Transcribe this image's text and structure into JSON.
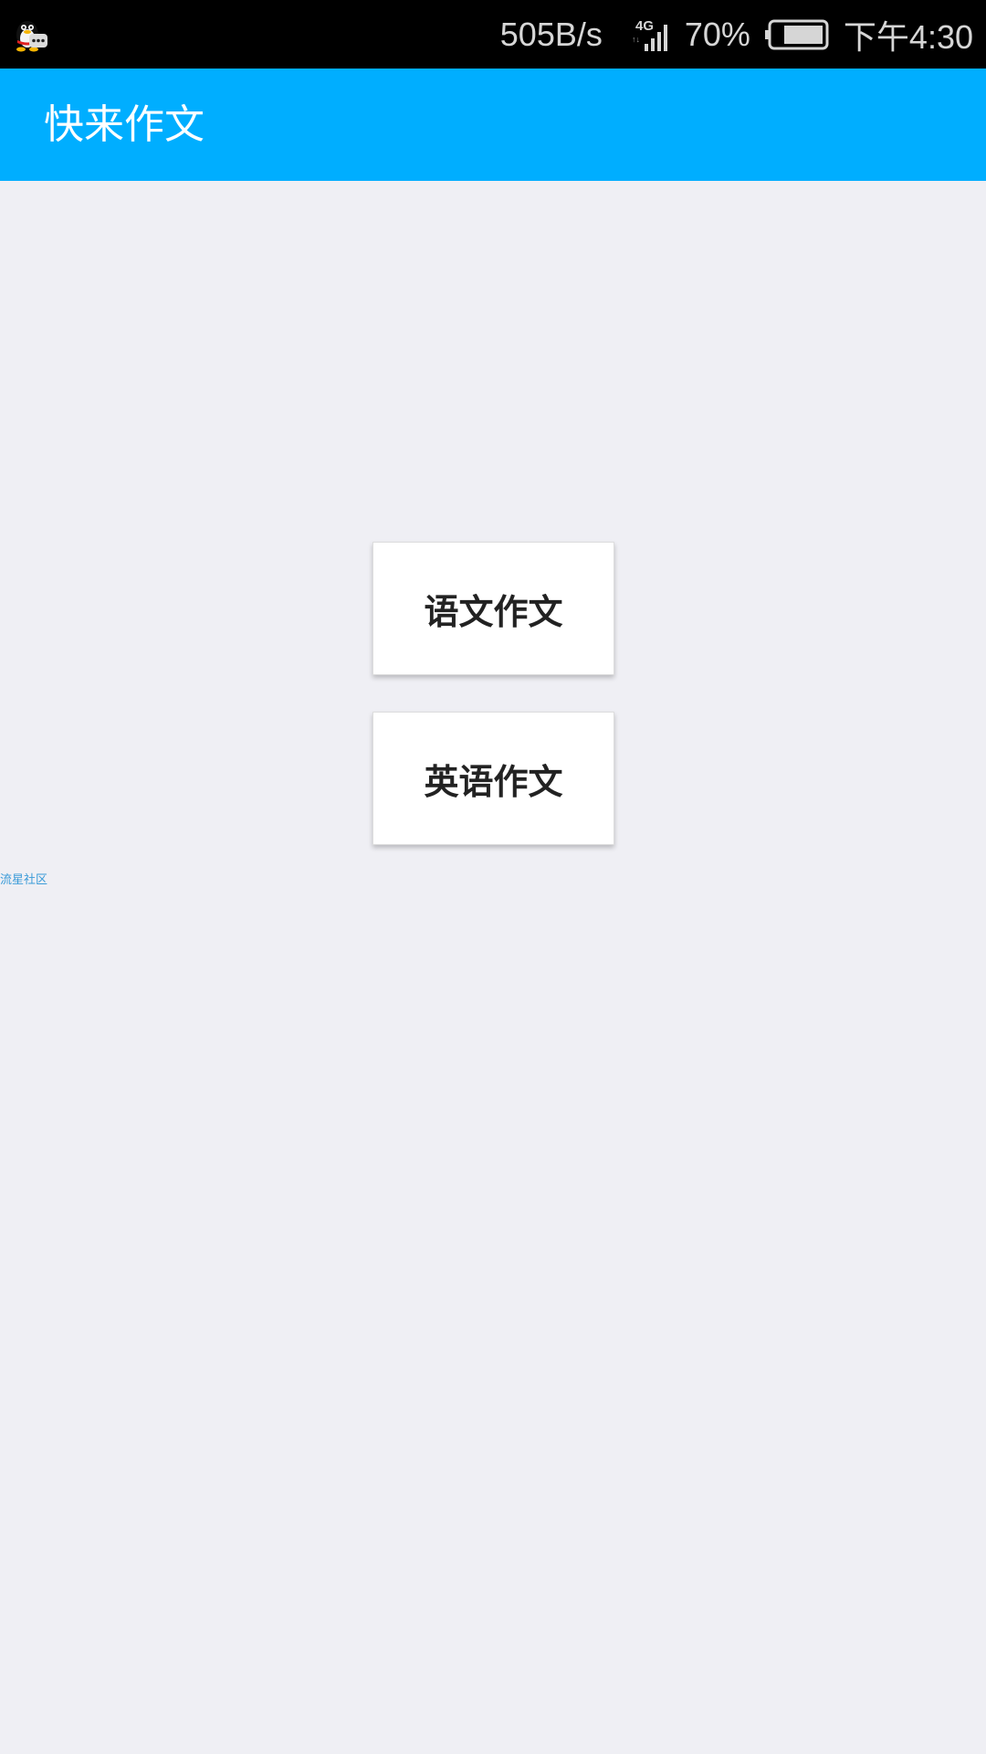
{
  "status_bar": {
    "net_speed": "505B/s",
    "network_type": "4G",
    "battery": "70%",
    "time": "下午4:30",
    "notification_icon": "qq-penguin-icon"
  },
  "app_bar": {
    "title": "快来作文",
    "color": "#00aeff"
  },
  "main": {
    "buttons": [
      {
        "label": "语文作文"
      },
      {
        "label": "英语作文"
      }
    ],
    "watermark": "流星社区"
  },
  "colors": {
    "accent": "#00aeff",
    "background": "#efeff4",
    "status_bar": "#000000"
  }
}
